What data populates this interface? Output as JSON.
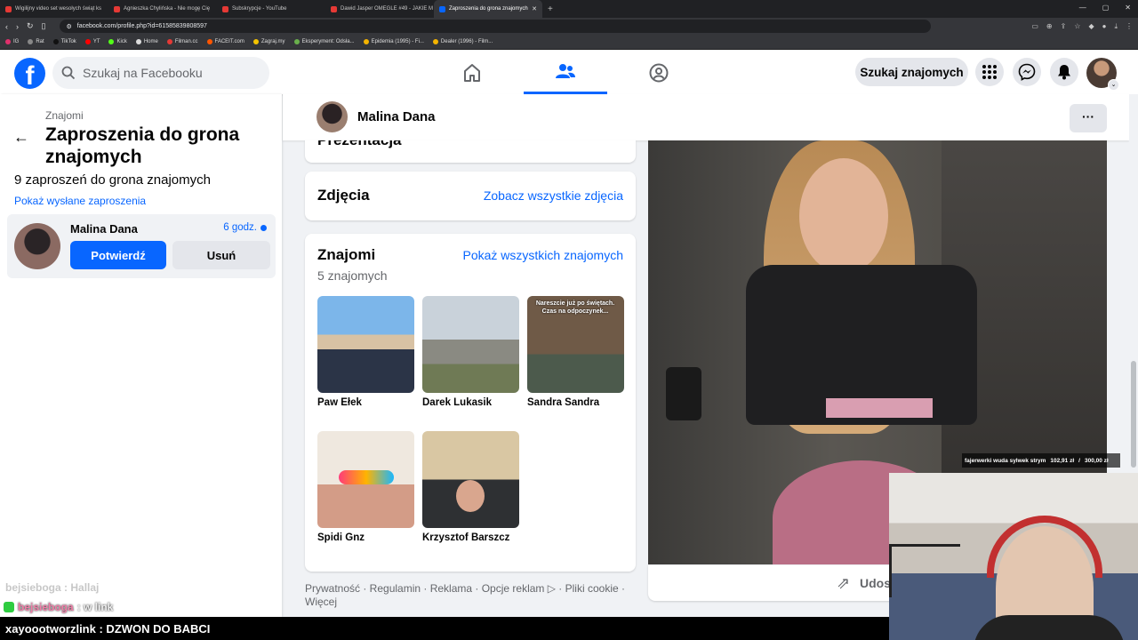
{
  "browser": {
    "tabs": [
      {
        "title": "Wigilijny video set wesołych świąt ks"
      },
      {
        "title": "Agnieszka Chylińska - Nie mogę Cię"
      },
      {
        "title": "Subskrypcje - YouTube"
      },
      {
        "title": "Dawid Jasper OMEGLE #49 - JAKIE M"
      },
      {
        "title": "Zaproszenia do grona znajomych",
        "active": true
      }
    ],
    "url": "facebook.com/profile.php?id=61585839808597",
    "bookmarks": [
      "IG",
      "Rat",
      "TikTok",
      "YT",
      "Kick",
      "Home",
      "Filman.cc",
      "FACEIT.com",
      "Zagraj.my",
      "Eksperyment: Odsła...",
      "Epidemia (1995) - Fi...",
      "Dealer (1996) - Film..."
    ]
  },
  "fb": {
    "logo": "f",
    "search_placeholder": "Szukaj na Facebooku",
    "find_friends": "Szukaj znajomych",
    "accent": "#0866ff"
  },
  "sidebar": {
    "crumb": "Znajomi",
    "title": "Zaproszenia do grona znajomych",
    "count": "9 zaproszeń do grona znajomych",
    "sent_link": "Pokaż wysłane zaproszenia",
    "request": {
      "name": "Malina Dana",
      "time": "6 godz.",
      "confirm": "Potwierdź",
      "delete": "Usuń"
    }
  },
  "profile": {
    "name": "Malina Dana",
    "more": "···",
    "partial_heading": "Prezentacja",
    "photos": {
      "title": "Zdjęcia",
      "link": "Zobacz wszystkie zdjęcia"
    },
    "friends": {
      "title": "Znajomi",
      "link": "Pokaż wszystkich znajomych",
      "count": "5 znajomych",
      "items": [
        {
          "name": "Paw Ełek"
        },
        {
          "name": "Darek Lukasik"
        },
        {
          "name": "Sandra Sandra",
          "caption": "Nareszcie już po świętach. Czas na odpoczynek..."
        },
        {
          "name": "Spidi Gnz"
        },
        {
          "name": "Krzysztof Barszcz"
        }
      ]
    },
    "footer": "Prywatność · Regulamin · Reklama · Opcje reklam ▷ · Pliki cookie · Więcej",
    "share": "Udost"
  },
  "stream": {
    "goal": "fajerwerki wuda sylwek strym",
    "goal_current": "102,91 zł",
    "goal_target": "300,00 zł",
    "chat_faded": "bejsieboga : Hallaj",
    "chat_user": "bejsieboga",
    "chat_msg": ": w link",
    "bottom_user": "xayoootworzlink",
    "bottom_msg": ": DZWON DO BABCI"
  }
}
